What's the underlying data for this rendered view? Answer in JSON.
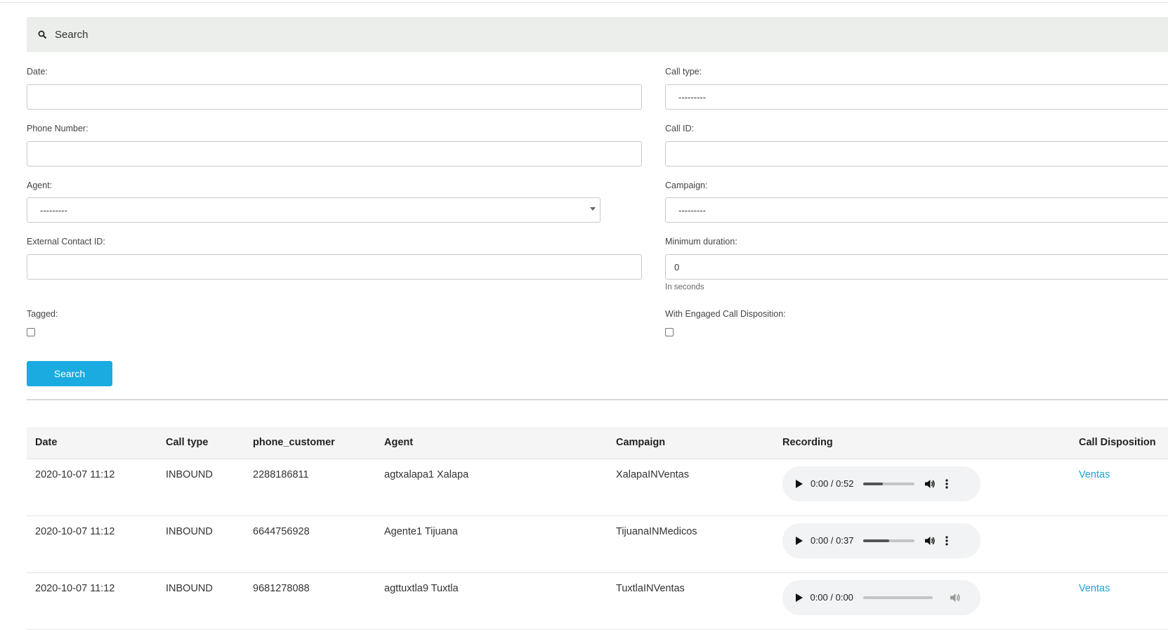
{
  "search_panel": {
    "title": "Search",
    "icon": "search-icon"
  },
  "form": {
    "date": {
      "label": "Date:",
      "value": ""
    },
    "call_type": {
      "label": "Call type:",
      "value": "---------"
    },
    "phone_number": {
      "label": "Phone Number:",
      "value": ""
    },
    "call_id": {
      "label": "Call ID:",
      "value": ""
    },
    "agent": {
      "label": "Agent:",
      "value": "---------"
    },
    "campaign": {
      "label": "Campaign:",
      "value": "---------"
    },
    "external_contact_id": {
      "label": "External Contact ID:",
      "value": ""
    },
    "minimum_duration": {
      "label": "Minimum duration:",
      "value": "0",
      "help": "In seconds"
    },
    "tagged": {
      "label": "Tagged:",
      "checked": false
    },
    "engaged_disposition": {
      "label": "With Engaged Call Disposition:",
      "checked": false
    },
    "search_button": "Search"
  },
  "table": {
    "columns": [
      "Date",
      "Call type",
      "phone_customer",
      "Agent",
      "Campaign",
      "Recording",
      "Call Disposition"
    ],
    "rows": [
      {
        "date": "2020-10-07 11:12",
        "call_type": "INBOUND",
        "phone_customer": "2288186811",
        "agent": "agtxalapa1 Xalapa",
        "campaign": "XalapaINVentas",
        "recording_time": "0:00 / 0:52",
        "recording_buffered": 0.38,
        "disposition": "Ventas"
      },
      {
        "date": "2020-10-07 11:12",
        "call_type": "INBOUND",
        "phone_customer": "6644756928",
        "agent": "Agente1 Tijuana",
        "campaign": "TijuanaINMedicos",
        "recording_time": "0:00 / 0:37",
        "recording_buffered": 0.5,
        "disposition": ""
      },
      {
        "date": "2020-10-07 11:12",
        "call_type": "INBOUND",
        "phone_customer": "9681278088",
        "agent": "agttuxtla9 Tuxtla",
        "campaign": "TuxtlaINVentas",
        "recording_time": "0:00 / 0:00",
        "recording_buffered": 0,
        "disposition": "Ventas"
      }
    ]
  },
  "colors": {
    "accent": "#1aabe0",
    "panel_bg": "#eceeeb",
    "link": "#1aa5d8"
  }
}
